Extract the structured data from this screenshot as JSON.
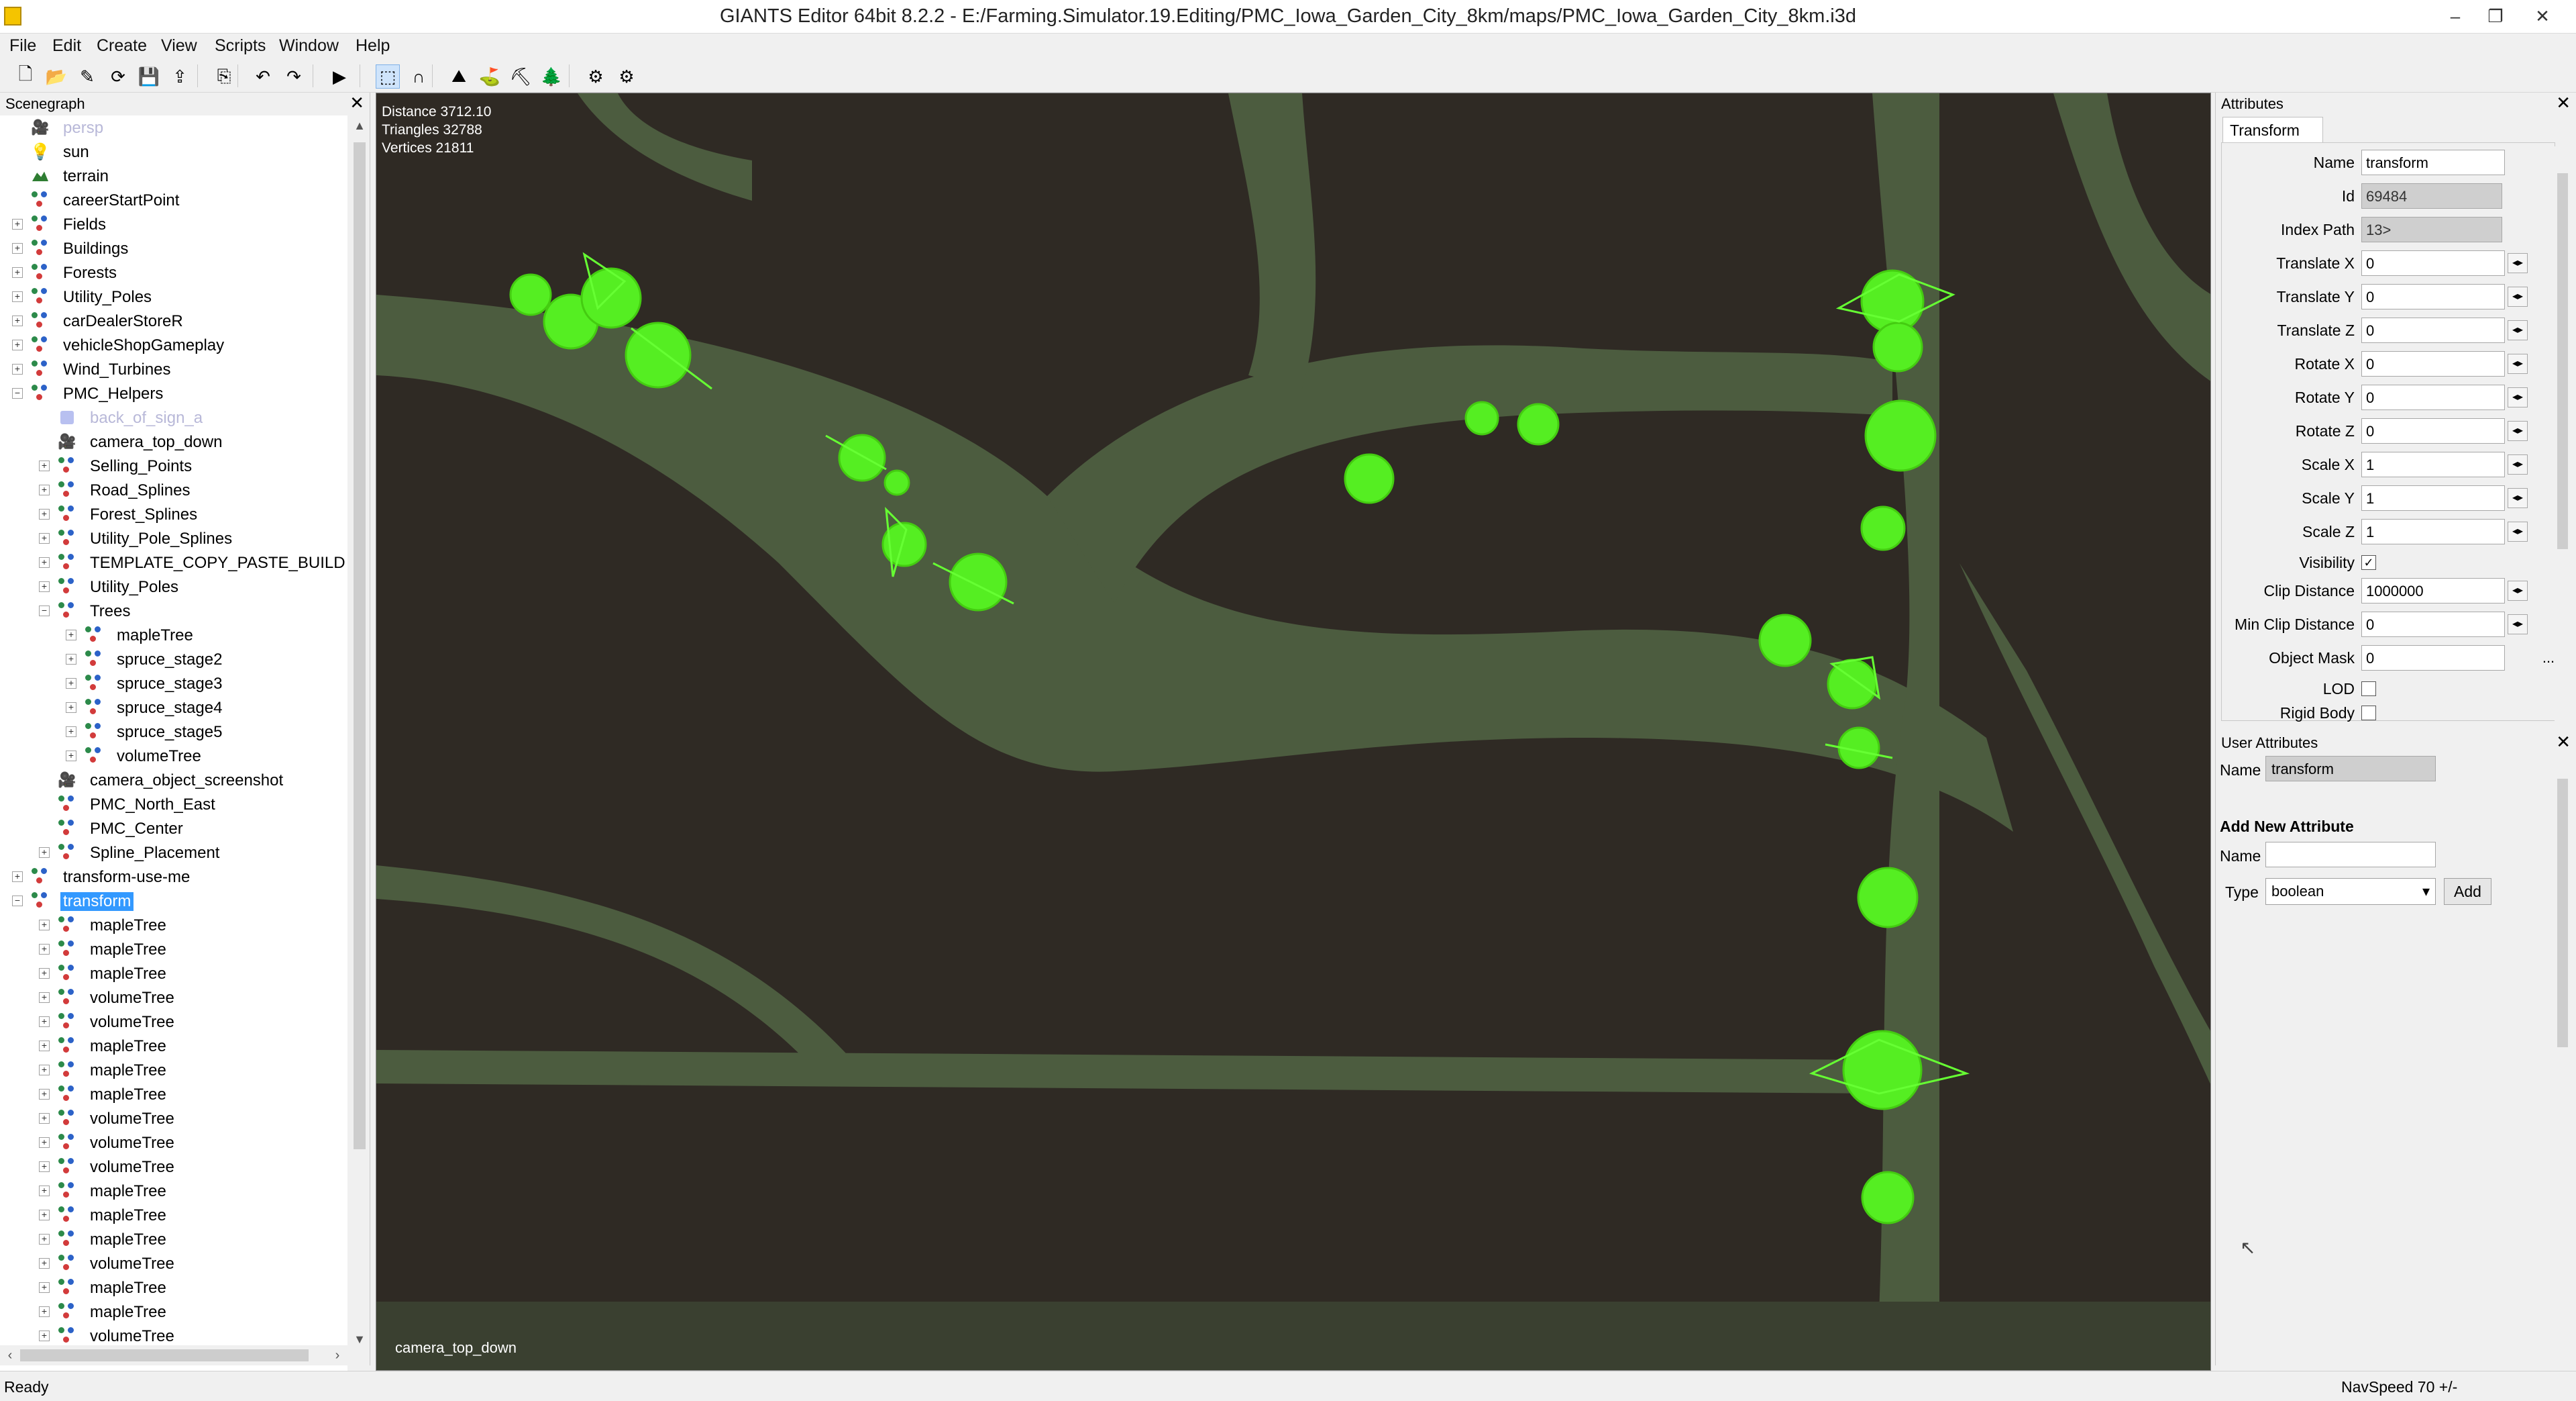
{
  "window": {
    "title": "GIANTS Editor 64bit 8.2.2 - E:/Farming.Simulator.19.Editing/PMC_Iowa_Garden_City_8km/maps/PMC_Iowa_Garden_City_8km.i3d",
    "minimize": "–",
    "restore": "❐",
    "close": "✕"
  },
  "menu": [
    "File",
    "Edit",
    "Create",
    "View",
    "Scripts",
    "Window",
    "Help"
  ],
  "toolbar": {
    "icons": [
      "new-file-icon",
      "open-folder-icon",
      "edit-icon",
      "reload-icon",
      "save-icon",
      "save-as-icon",
      "import-icon",
      "undo-icon",
      "redo-icon",
      "play-icon",
      "select-tool-icon",
      "move-tool-icon",
      "paint-terrain-icon",
      "paint-foliage-icon",
      "paint-placement-icon",
      "paint-tree-icon",
      "settings-icon",
      "settings-advanced-icon"
    ],
    "glyphs": [
      "🗋",
      "📂",
      "✎",
      "⟳",
      "💾",
      "⇪",
      "⎘",
      "↶",
      "↷",
      "▶",
      "⬚",
      "∩",
      "⛰",
      "⛳",
      "⛏",
      "🌲",
      "⚙",
      "⚙"
    ]
  },
  "scenegraph": {
    "title": "Scenegraph",
    "close": "✕",
    "items": [
      {
        "label": "persp",
        "depth": 0,
        "expander": "",
        "icon": "camera",
        "dim": true
      },
      {
        "label": "sun",
        "depth": 0,
        "expander": "",
        "icon": "light"
      },
      {
        "label": "terrain",
        "depth": 0,
        "expander": "",
        "icon": "terrain"
      },
      {
        "label": "careerStartPoint",
        "depth": 0,
        "expander": "",
        "icon": "transform"
      },
      {
        "label": "Fields",
        "depth": 0,
        "expander": "+",
        "icon": "transform"
      },
      {
        "label": "Buildings",
        "depth": 0,
        "expander": "+",
        "icon": "transform"
      },
      {
        "label": "Forests",
        "depth": 0,
        "expander": "+",
        "icon": "transform"
      },
      {
        "label": "Utility_Poles",
        "depth": 0,
        "expander": "+",
        "icon": "transform"
      },
      {
        "label": "carDealerStoreR",
        "depth": 0,
        "expander": "+",
        "icon": "transform"
      },
      {
        "label": "vehicleShopGameplay",
        "depth": 0,
        "expander": "+",
        "icon": "transform"
      },
      {
        "label": "Wind_Turbines",
        "depth": 0,
        "expander": "+",
        "icon": "transform"
      },
      {
        "label": "PMC_Helpers",
        "depth": 0,
        "expander": "−",
        "icon": "transform"
      },
      {
        "label": "back_of_sign_a",
        "depth": 1,
        "expander": "",
        "icon": "shape",
        "dim": true
      },
      {
        "label": "camera_top_down",
        "depth": 1,
        "expander": "",
        "icon": "camera"
      },
      {
        "label": "Selling_Points",
        "depth": 1,
        "expander": "+",
        "icon": "transform"
      },
      {
        "label": "Road_Splines",
        "depth": 1,
        "expander": "+",
        "icon": "transform"
      },
      {
        "label": "Forest_Splines",
        "depth": 1,
        "expander": "+",
        "icon": "transform"
      },
      {
        "label": "Utility_Pole_Splines",
        "depth": 1,
        "expander": "+",
        "icon": "transform"
      },
      {
        "label": "TEMPLATE_COPY_PASTE_BUILD",
        "depth": 1,
        "expander": "+",
        "icon": "transform"
      },
      {
        "label": "Utility_Poles",
        "depth": 1,
        "expander": "+",
        "icon": "transform"
      },
      {
        "label": "Trees",
        "depth": 1,
        "expander": "−",
        "icon": "transform"
      },
      {
        "label": "mapleTree",
        "depth": 2,
        "expander": "+",
        "icon": "transform"
      },
      {
        "label": "spruce_stage2",
        "depth": 2,
        "expander": "+",
        "icon": "transform"
      },
      {
        "label": "spruce_stage3",
        "depth": 2,
        "expander": "+",
        "icon": "transform"
      },
      {
        "label": "spruce_stage4",
        "depth": 2,
        "expander": "+",
        "icon": "transform"
      },
      {
        "label": "spruce_stage5",
        "depth": 2,
        "expander": "+",
        "icon": "transform"
      },
      {
        "label": "volumeTree",
        "depth": 2,
        "expander": "+",
        "icon": "transform"
      },
      {
        "label": "camera_object_screenshot",
        "depth": 1,
        "expander": "",
        "icon": "camera"
      },
      {
        "label": "PMC_North_East",
        "depth": 1,
        "expander": "",
        "icon": "transform"
      },
      {
        "label": "PMC_Center",
        "depth": 1,
        "expander": "",
        "icon": "transform"
      },
      {
        "label": "Spline_Placement",
        "depth": 1,
        "expander": "+",
        "icon": "transform"
      },
      {
        "label": "transform-use-me",
        "depth": 0,
        "expander": "+",
        "icon": "transform"
      },
      {
        "label": "transform",
        "depth": 0,
        "expander": "−",
        "icon": "transform",
        "selected": true
      },
      {
        "label": "mapleTree",
        "depth": 1,
        "expander": "+",
        "icon": "transform"
      },
      {
        "label": "mapleTree",
        "depth": 1,
        "expander": "+",
        "icon": "transform"
      },
      {
        "label": "mapleTree",
        "depth": 1,
        "expander": "+",
        "icon": "transform"
      },
      {
        "label": "volumeTree",
        "depth": 1,
        "expander": "+",
        "icon": "transform"
      },
      {
        "label": "volumeTree",
        "depth": 1,
        "expander": "+",
        "icon": "transform"
      },
      {
        "label": "mapleTree",
        "depth": 1,
        "expander": "+",
        "icon": "transform"
      },
      {
        "label": "mapleTree",
        "depth": 1,
        "expander": "+",
        "icon": "transform"
      },
      {
        "label": "mapleTree",
        "depth": 1,
        "expander": "+",
        "icon": "transform"
      },
      {
        "label": "volumeTree",
        "depth": 1,
        "expander": "+",
        "icon": "transform"
      },
      {
        "label": "volumeTree",
        "depth": 1,
        "expander": "+",
        "icon": "transform"
      },
      {
        "label": "volumeTree",
        "depth": 1,
        "expander": "+",
        "icon": "transform"
      },
      {
        "label": "mapleTree",
        "depth": 1,
        "expander": "+",
        "icon": "transform"
      },
      {
        "label": "mapleTree",
        "depth": 1,
        "expander": "+",
        "icon": "transform"
      },
      {
        "label": "mapleTree",
        "depth": 1,
        "expander": "+",
        "icon": "transform"
      },
      {
        "label": "volumeTree",
        "depth": 1,
        "expander": "+",
        "icon": "transform"
      },
      {
        "label": "mapleTree",
        "depth": 1,
        "expander": "+",
        "icon": "transform"
      },
      {
        "label": "mapleTree",
        "depth": 1,
        "expander": "+",
        "icon": "transform"
      },
      {
        "label": "volumeTree",
        "depth": 1,
        "expander": "+",
        "icon": "transform"
      }
    ]
  },
  "viewport": {
    "stats": {
      "distance": "Distance 3712.10",
      "triangles": "Triangles 32788",
      "vertices": "Vertices 21811"
    },
    "camera": "camera_top_down",
    "colors": {
      "ground": "#2f2a24",
      "grass": "#4a5a3c",
      "trees": "#55ee22"
    }
  },
  "attributes": {
    "title": "Attributes",
    "close": "✕",
    "tab": "Transform",
    "fields": [
      {
        "label": "Name",
        "value": "transform",
        "kind": "text"
      },
      {
        "label": "Id",
        "value": "69484",
        "kind": "readonly"
      },
      {
        "label": "Index Path",
        "value": "13>",
        "kind": "readonly"
      },
      {
        "label": "Translate X",
        "value": "0",
        "kind": "spin"
      },
      {
        "label": "Translate Y",
        "value": "0",
        "kind": "spin"
      },
      {
        "label": "Translate Z",
        "value": "0",
        "kind": "spin"
      },
      {
        "label": "Rotate X",
        "value": "0",
        "kind": "spin"
      },
      {
        "label": "Rotate Y",
        "value": "0",
        "kind": "spin"
      },
      {
        "label": "Rotate Z",
        "value": "0",
        "kind": "spin"
      },
      {
        "label": "Scale X",
        "value": "1",
        "kind": "spin"
      },
      {
        "label": "Scale Y",
        "value": "1",
        "kind": "spin"
      },
      {
        "label": "Scale Z",
        "value": "1",
        "kind": "spin"
      },
      {
        "label": "Visibility",
        "value": "✓",
        "kind": "check"
      },
      {
        "label": "Clip Distance",
        "value": "1000000",
        "kind": "spin"
      },
      {
        "label": "Min Clip Distance",
        "value": "0",
        "kind": "spin"
      },
      {
        "label": "Object Mask",
        "value": "0",
        "kind": "more"
      },
      {
        "label": "LOD",
        "value": "",
        "kind": "check"
      },
      {
        "label": "Rigid Body",
        "value": "",
        "kind": "check"
      }
    ],
    "spin_glyph": "◂▸",
    "more_glyph": "..."
  },
  "user_attributes": {
    "title": "User Attributes",
    "close": "✕",
    "name_label": "Name",
    "name_value": "transform",
    "add_heading": "Add New Attribute",
    "new_name_label": "Name",
    "new_name_value": "",
    "type_label": "Type",
    "type_value": "boolean",
    "add_button": "Add"
  },
  "status": {
    "left": "Ready",
    "right": "NavSpeed 70 +/-"
  }
}
